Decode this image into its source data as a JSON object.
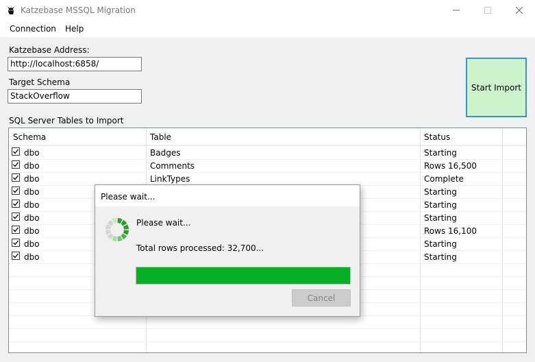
{
  "window": {
    "title": "Katzebase MSSQL Migration"
  },
  "menu": {
    "items": [
      "Connection",
      "Help"
    ]
  },
  "form": {
    "address_label": "Katzebase Address:",
    "address_value": "http://localhost:6858/",
    "schema_label": "Target Schema",
    "schema_value": "StackOverflow",
    "tables_label": "SQL Server Tables to Import",
    "start_button": "Start Import"
  },
  "table": {
    "columns": [
      "Schema",
      "Table",
      "Status"
    ],
    "rows": [
      {
        "checked": true,
        "schema": "dbo",
        "table": "Badges",
        "status": "Starting"
      },
      {
        "checked": true,
        "schema": "dbo",
        "table": "Comments",
        "status": "Rows 16,500"
      },
      {
        "checked": true,
        "schema": "dbo",
        "table": "LinkTypes",
        "status": "Complete"
      },
      {
        "checked": true,
        "schema": "dbo",
        "table": "",
        "status": "Starting"
      },
      {
        "checked": true,
        "schema": "dbo",
        "table": "",
        "status": "Starting"
      },
      {
        "checked": true,
        "schema": "dbo",
        "table": "",
        "status": "Starting"
      },
      {
        "checked": true,
        "schema": "dbo",
        "table": "",
        "status": "Rows 16,100"
      },
      {
        "checked": true,
        "schema": "dbo",
        "table": "",
        "status": "Starting"
      },
      {
        "checked": true,
        "schema": "dbo",
        "table": "",
        "status": "Starting"
      }
    ]
  },
  "dialog": {
    "title": "Please wait...",
    "message": "Please wait...",
    "rows_text": "Total rows processed: 32,700...",
    "progress_fraction": 1.0,
    "cancel_label": "Cancel",
    "spinner_icon": "spinner-icon"
  },
  "colors": {
    "progress": "#06b025",
    "start_button_bg": "#ccf3cc",
    "start_button_border": "#3c8fdf"
  }
}
